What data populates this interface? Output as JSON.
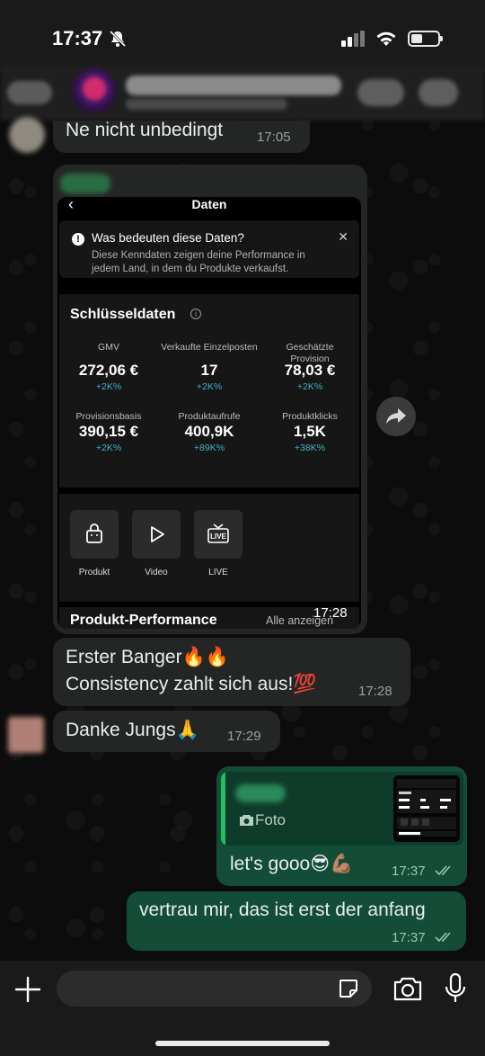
{
  "status": {
    "time": "17:37"
  },
  "messages": {
    "m1": {
      "text": "Ne nicht unbedingt",
      "time": "17:05"
    },
    "image_post": {
      "time": "17:28"
    },
    "m2": {
      "line1": "Erster Banger🔥🔥",
      "line2": "Consistency zahlt sich aus!💯",
      "time": "17:28"
    },
    "m3": {
      "text": "Danke Jungs🙏",
      "time": "17:29"
    },
    "m4": {
      "reply_label": "Foto",
      "text": "let's gooo😎💪🏽",
      "time": "17:37",
      "status": "read"
    },
    "m5": {
      "text": "vertrau mir, das ist erst der anfang",
      "time": "17:37",
      "status": "read"
    }
  },
  "screenshot": {
    "title": "Daten",
    "info_title": "Was bedeuten diese Daten?",
    "info_text": "Diese Kenndaten zeigen deine Performance in jedem Land, in dem du Produkte verkaufst.",
    "key_data_title": "Schlüsseldaten",
    "metrics": [
      {
        "label": "GMV",
        "value": "272,06 €",
        "delta": "+2K%"
      },
      {
        "label": "Verkaufte Einzelposten",
        "value": "17",
        "delta": "+2K%"
      },
      {
        "label": "Geschätzte Provision",
        "value": "78,03 €",
        "delta": "+2K%"
      },
      {
        "label": "Provisionsbasis",
        "value": "390,15 €",
        "delta": "+2K%"
      },
      {
        "label": "Produktaufrufe",
        "value": "400,9K",
        "delta": "+89K%"
      },
      {
        "label": "Produktklicks",
        "value": "1,5K",
        "delta": "+38K%"
      }
    ],
    "tiles": [
      "Produkt",
      "Video",
      "LIVE"
    ],
    "live_icon_text": "LIVE",
    "product_perf_title": "Produkt-Performance",
    "product_perf_link": "Alle anzeigen"
  },
  "colors": {
    "incoming": "#242626",
    "outgoing": "#144d37",
    "accent": "#21c063"
  }
}
